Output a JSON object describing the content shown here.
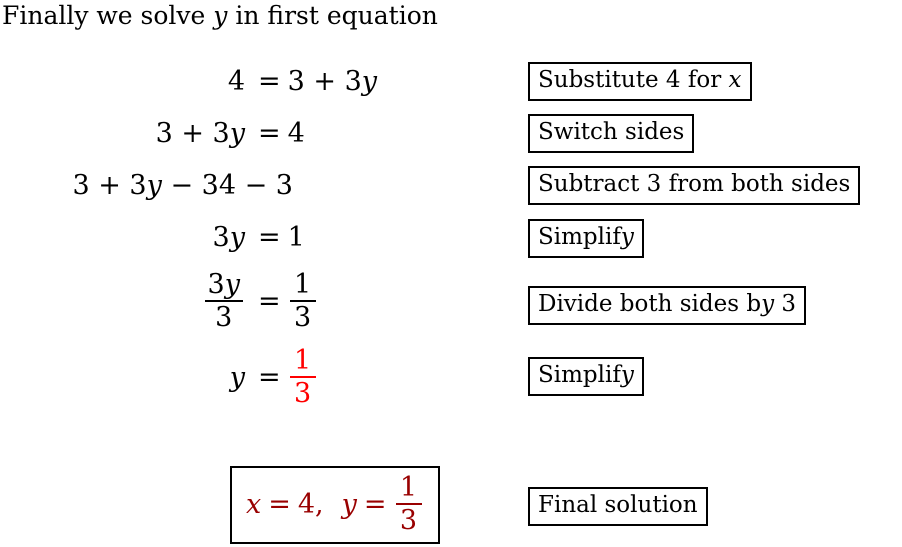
{
  "heading": {
    "pre": "Finally we solve ",
    "var": "y",
    "post": " in first equation"
  },
  "colors": {
    "text": "#000000",
    "highlight_red": "#ff0000",
    "answer_red": "#990000",
    "box_border": "#000000",
    "background": "#ffffff"
  },
  "steps": [
    {
      "left": "4",
      "relation": "=",
      "right": "3 + 3y",
      "note": "Substitute 4 for x",
      "note_var": "x"
    },
    {
      "left": "3 + 3y",
      "relation": "=",
      "right": "4",
      "note": "Switch sides"
    },
    {
      "left": "3 + 3y − 34 − 3",
      "relation": "",
      "right": "",
      "note": "Subtract 3 from both sides"
    },
    {
      "left": "3y",
      "relation": "=",
      "right": "1",
      "note": "Simplify"
    },
    {
      "left_frac": {
        "num": "3y",
        "den": "3"
      },
      "relation": "=",
      "right_frac": {
        "num": "1",
        "den": "3"
      },
      "note": "Divide both sides by 3"
    },
    {
      "left": "y",
      "relation": "=",
      "right_frac": {
        "num": "1",
        "den": "3"
      },
      "right_frac_color": "red",
      "note": "Simplify"
    }
  ],
  "final": {
    "x_var": "x",
    "x_rel": "=",
    "x_val": "4,",
    "y_var": "y",
    "y_rel": "=",
    "y_frac": {
      "num": "1",
      "den": "3"
    },
    "note": "Final solution"
  }
}
